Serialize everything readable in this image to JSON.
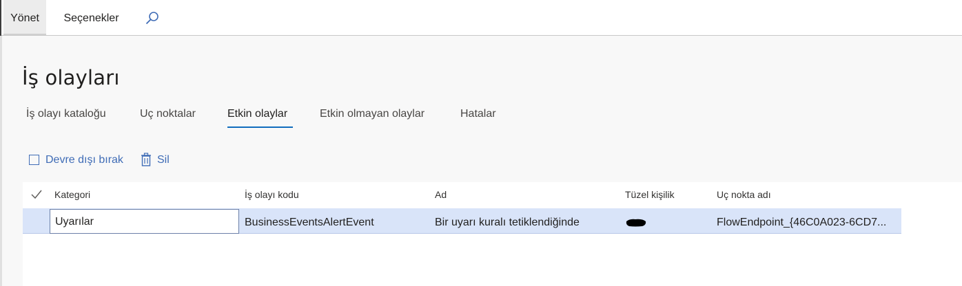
{
  "topbar": {
    "tabs": [
      {
        "label": "Yönet"
      },
      {
        "label": "Seçenekler"
      }
    ],
    "search_icon": "search-icon"
  },
  "page": {
    "title": "İş olayları",
    "tabs": [
      {
        "label": "İş olayı kataloğu"
      },
      {
        "label": "Uç noktalar"
      },
      {
        "label": "Etkin olaylar",
        "active": true
      },
      {
        "label": "Etkin olmayan olaylar"
      },
      {
        "label": "Hatalar"
      }
    ]
  },
  "actions": {
    "deactivate_label": "Devre dışı bırak",
    "delete_label": "Sil"
  },
  "grid": {
    "columns": [
      "Kategori",
      "İş olayı kodu",
      "Ad",
      "Tüzel kişilik",
      "Uç nokta adı"
    ],
    "rows": [
      {
        "kategori": "Uyarılar",
        "kod": "BusinessEventsAlertEvent",
        "ad": "Bir uyarı kuralı tetiklendiğinde",
        "tuzel_kisilik": "",
        "uc_nokta_adi": "FlowEndpoint_{46C0A023-6CD7..."
      }
    ]
  },
  "colors": {
    "accent": "#0f6cbd",
    "action_text": "#3f6cb6",
    "selected_row": "#d9e4f9"
  }
}
